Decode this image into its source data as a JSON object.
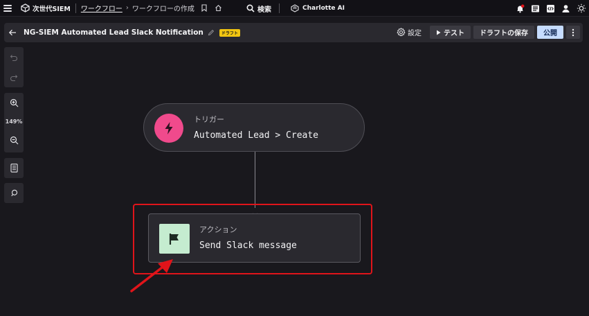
{
  "topbar": {
    "menu_icon": "hamburger-menu-icon",
    "product_name": "次世代SIEM",
    "breadcrumb_link": "ワークフロー",
    "breadcrumb_separator": "›",
    "breadcrumb_current": "ワークフローの作成",
    "search_label": "検索",
    "assistant_label": "Charlotte AI",
    "right_icons": [
      "bell-icon",
      "news-icon",
      "code-icon",
      "user-icon",
      "theme-sun-icon"
    ]
  },
  "header": {
    "title": "NG-SIEM Automated Lead Slack Notification",
    "badge": "ドラフト",
    "settings_label": "設定",
    "test_label": "テスト",
    "save_draft_label": "ドラフトの保存",
    "publish_label": "公開"
  },
  "toolbar": {
    "zoom_level": "149%"
  },
  "trigger": {
    "kind": "トリガー",
    "action": "Automated Lead > Create",
    "color": "#f04a8c"
  },
  "action": {
    "kind": "アクション",
    "action": "Send Slack message",
    "color": "#c5ecd0"
  },
  "highlight_color": "#e0141a"
}
